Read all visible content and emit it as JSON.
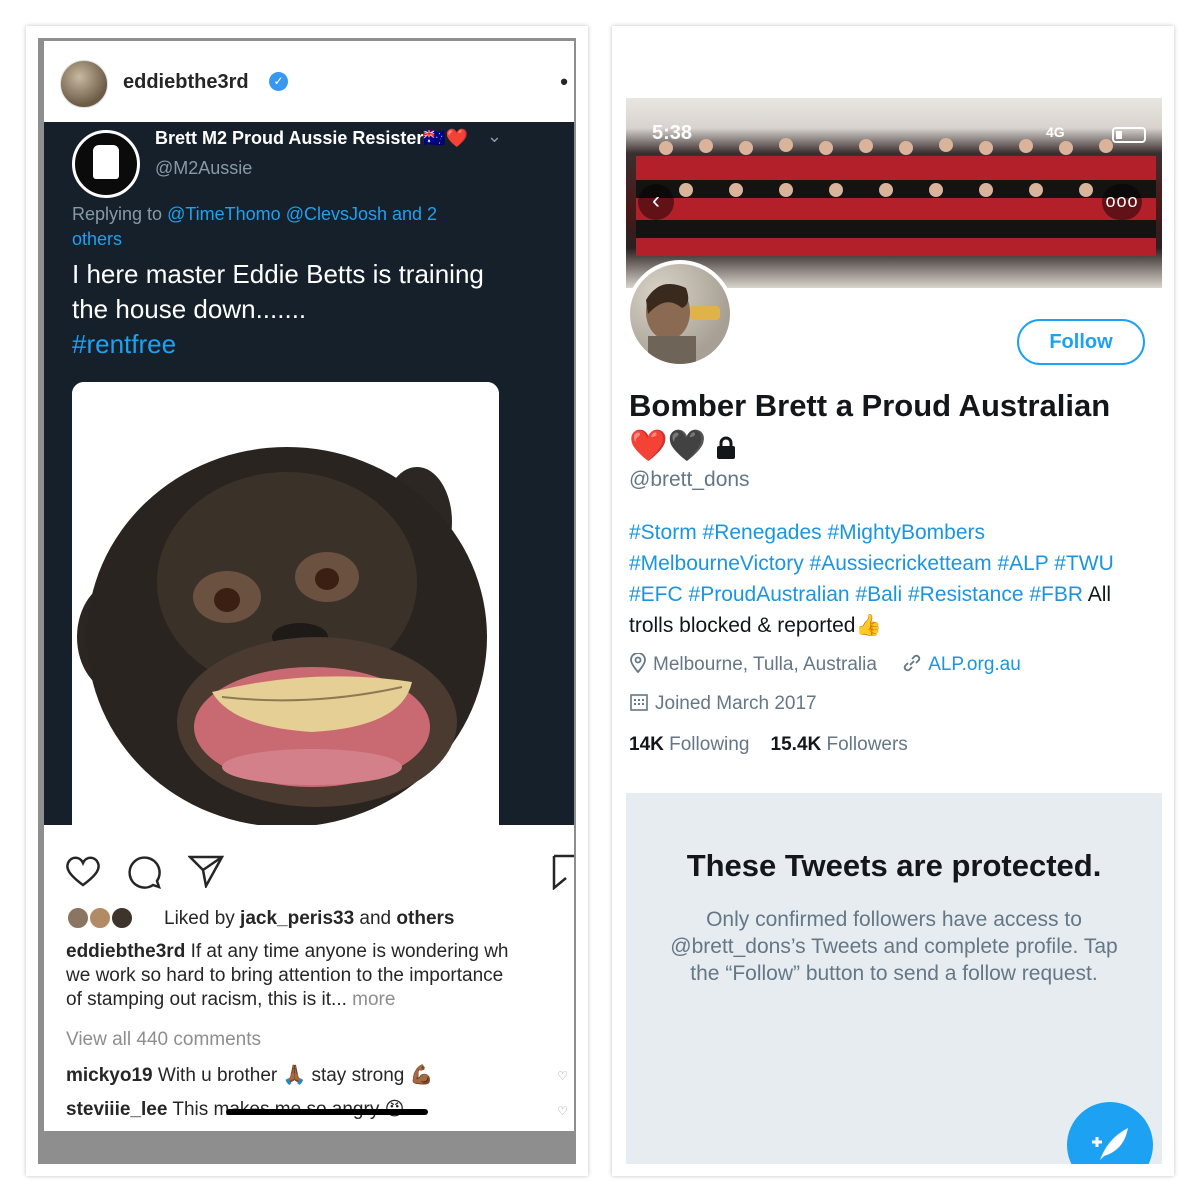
{
  "instagram": {
    "username": "eddiebthe3rd",
    "verified_glyph": "✓",
    "more_glyph": "•",
    "embedded_tweet": {
      "name": "Brett M2 Proud Aussie Resister🇦🇺❤️",
      "chevron": "⌄",
      "handle": "@M2Aussie",
      "replying_prefix": "Replying to ",
      "replying_mentions": "@TimeThomo @ClevsJosh and 2 others",
      "text": "I here master Eddie Betts is training the house down.......",
      "hashtag": "#rentfree"
    },
    "liked_prefix": "Liked by ",
    "liked_user": "jack_peris33",
    "liked_and": " and ",
    "liked_others": "others",
    "caption_user": "eddiebthe3rd",
    "caption_line1": " If at any time anyone is wondering wh",
    "caption_line2": "we work so hard to bring attention to the importance",
    "caption_line3": "of stamping out racism, this is it...",
    "caption_more": " more",
    "view_all": "View all 440 comments",
    "comments": [
      {
        "user": "mickyo19",
        "text": " With u brother 🙏🏾 stay strong 💪🏾"
      },
      {
        "user": "steviiie_lee",
        "text": " This makes me so angry 😡"
      }
    ],
    "icons": [
      "heart-icon",
      "comment-icon",
      "share-icon",
      "bookmark-icon"
    ]
  },
  "twitter": {
    "status_time": "5:38",
    "status_network": "4G",
    "back_glyph": "‹",
    "more_glyph": "ooo",
    "follow_label": "Follow",
    "display_name": "Bomber Brett a Proud Australian❤️🖤",
    "handle": "@brett_dons",
    "bio_hashtags": "#Storm #Renegades #MightyBombers #MelbourneVictory #Aussiecricketteam #ALP #TWU #EFC #ProudAustralian #Bali #Resistance #FBR",
    "bio_text": " All trolls blocked & reported👍",
    "location": "Melbourne, Tulla, Australia",
    "website": "ALP.org.au",
    "joined": "Joined March 2017",
    "following_count": "14K",
    "following_label": " Following",
    "followers_count": "15.4K",
    "followers_label": " Followers",
    "protected_title": "These Tweets are protected.",
    "protected_body": "Only confirmed followers have access to @brett_dons’s Tweets and complete profile. Tap the “Follow” button to send a follow request.",
    "compose_glyph": "+",
    "accent_color": "#1da1f2"
  }
}
